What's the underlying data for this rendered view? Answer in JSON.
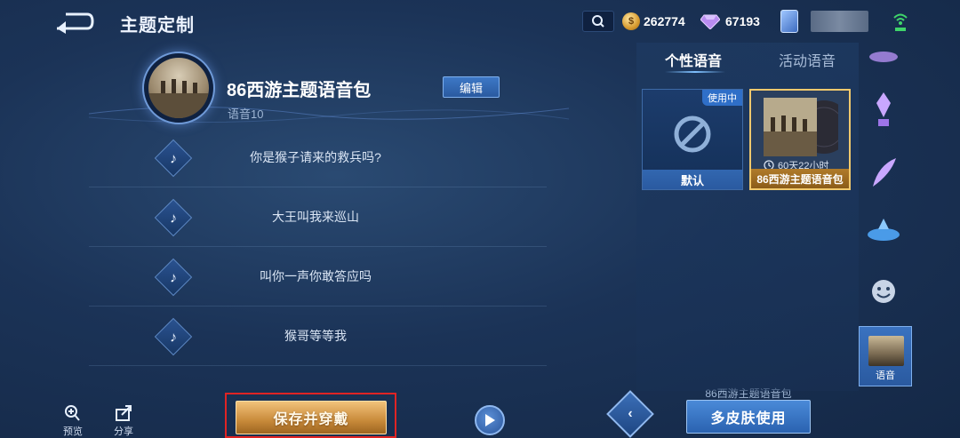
{
  "header": {
    "title": "主题定制",
    "coins": "262774",
    "gems": "67193"
  },
  "pack": {
    "title": "86西游主题语音包",
    "edit_label": "编辑",
    "voice_id": "语音10"
  },
  "voice_lines": [
    "你是猴子请来的救兵吗?",
    "大王叫我来巡山",
    "叫你一声你敢答应吗",
    "猴哥等等我"
  ],
  "bottom": {
    "preview_label": "预览",
    "share_label": "分享",
    "save_label": "保存并穿戴",
    "multi_caption": "86西游主题语音包",
    "multi_label": "多皮肤使用"
  },
  "right_panel": {
    "tabs": [
      "个性语音",
      "活动语音"
    ],
    "cards": [
      {
        "label": "默认",
        "badge": "使用中"
      },
      {
        "label": "86西游主题语音包",
        "timer": "60天22小时"
      }
    ]
  },
  "sidebar": {
    "selected_label": "语音"
  },
  "colors": {
    "accent_gold": "#c88a3a",
    "accent_blue": "#2a5aa0",
    "highlight_red": "#e02424"
  }
}
